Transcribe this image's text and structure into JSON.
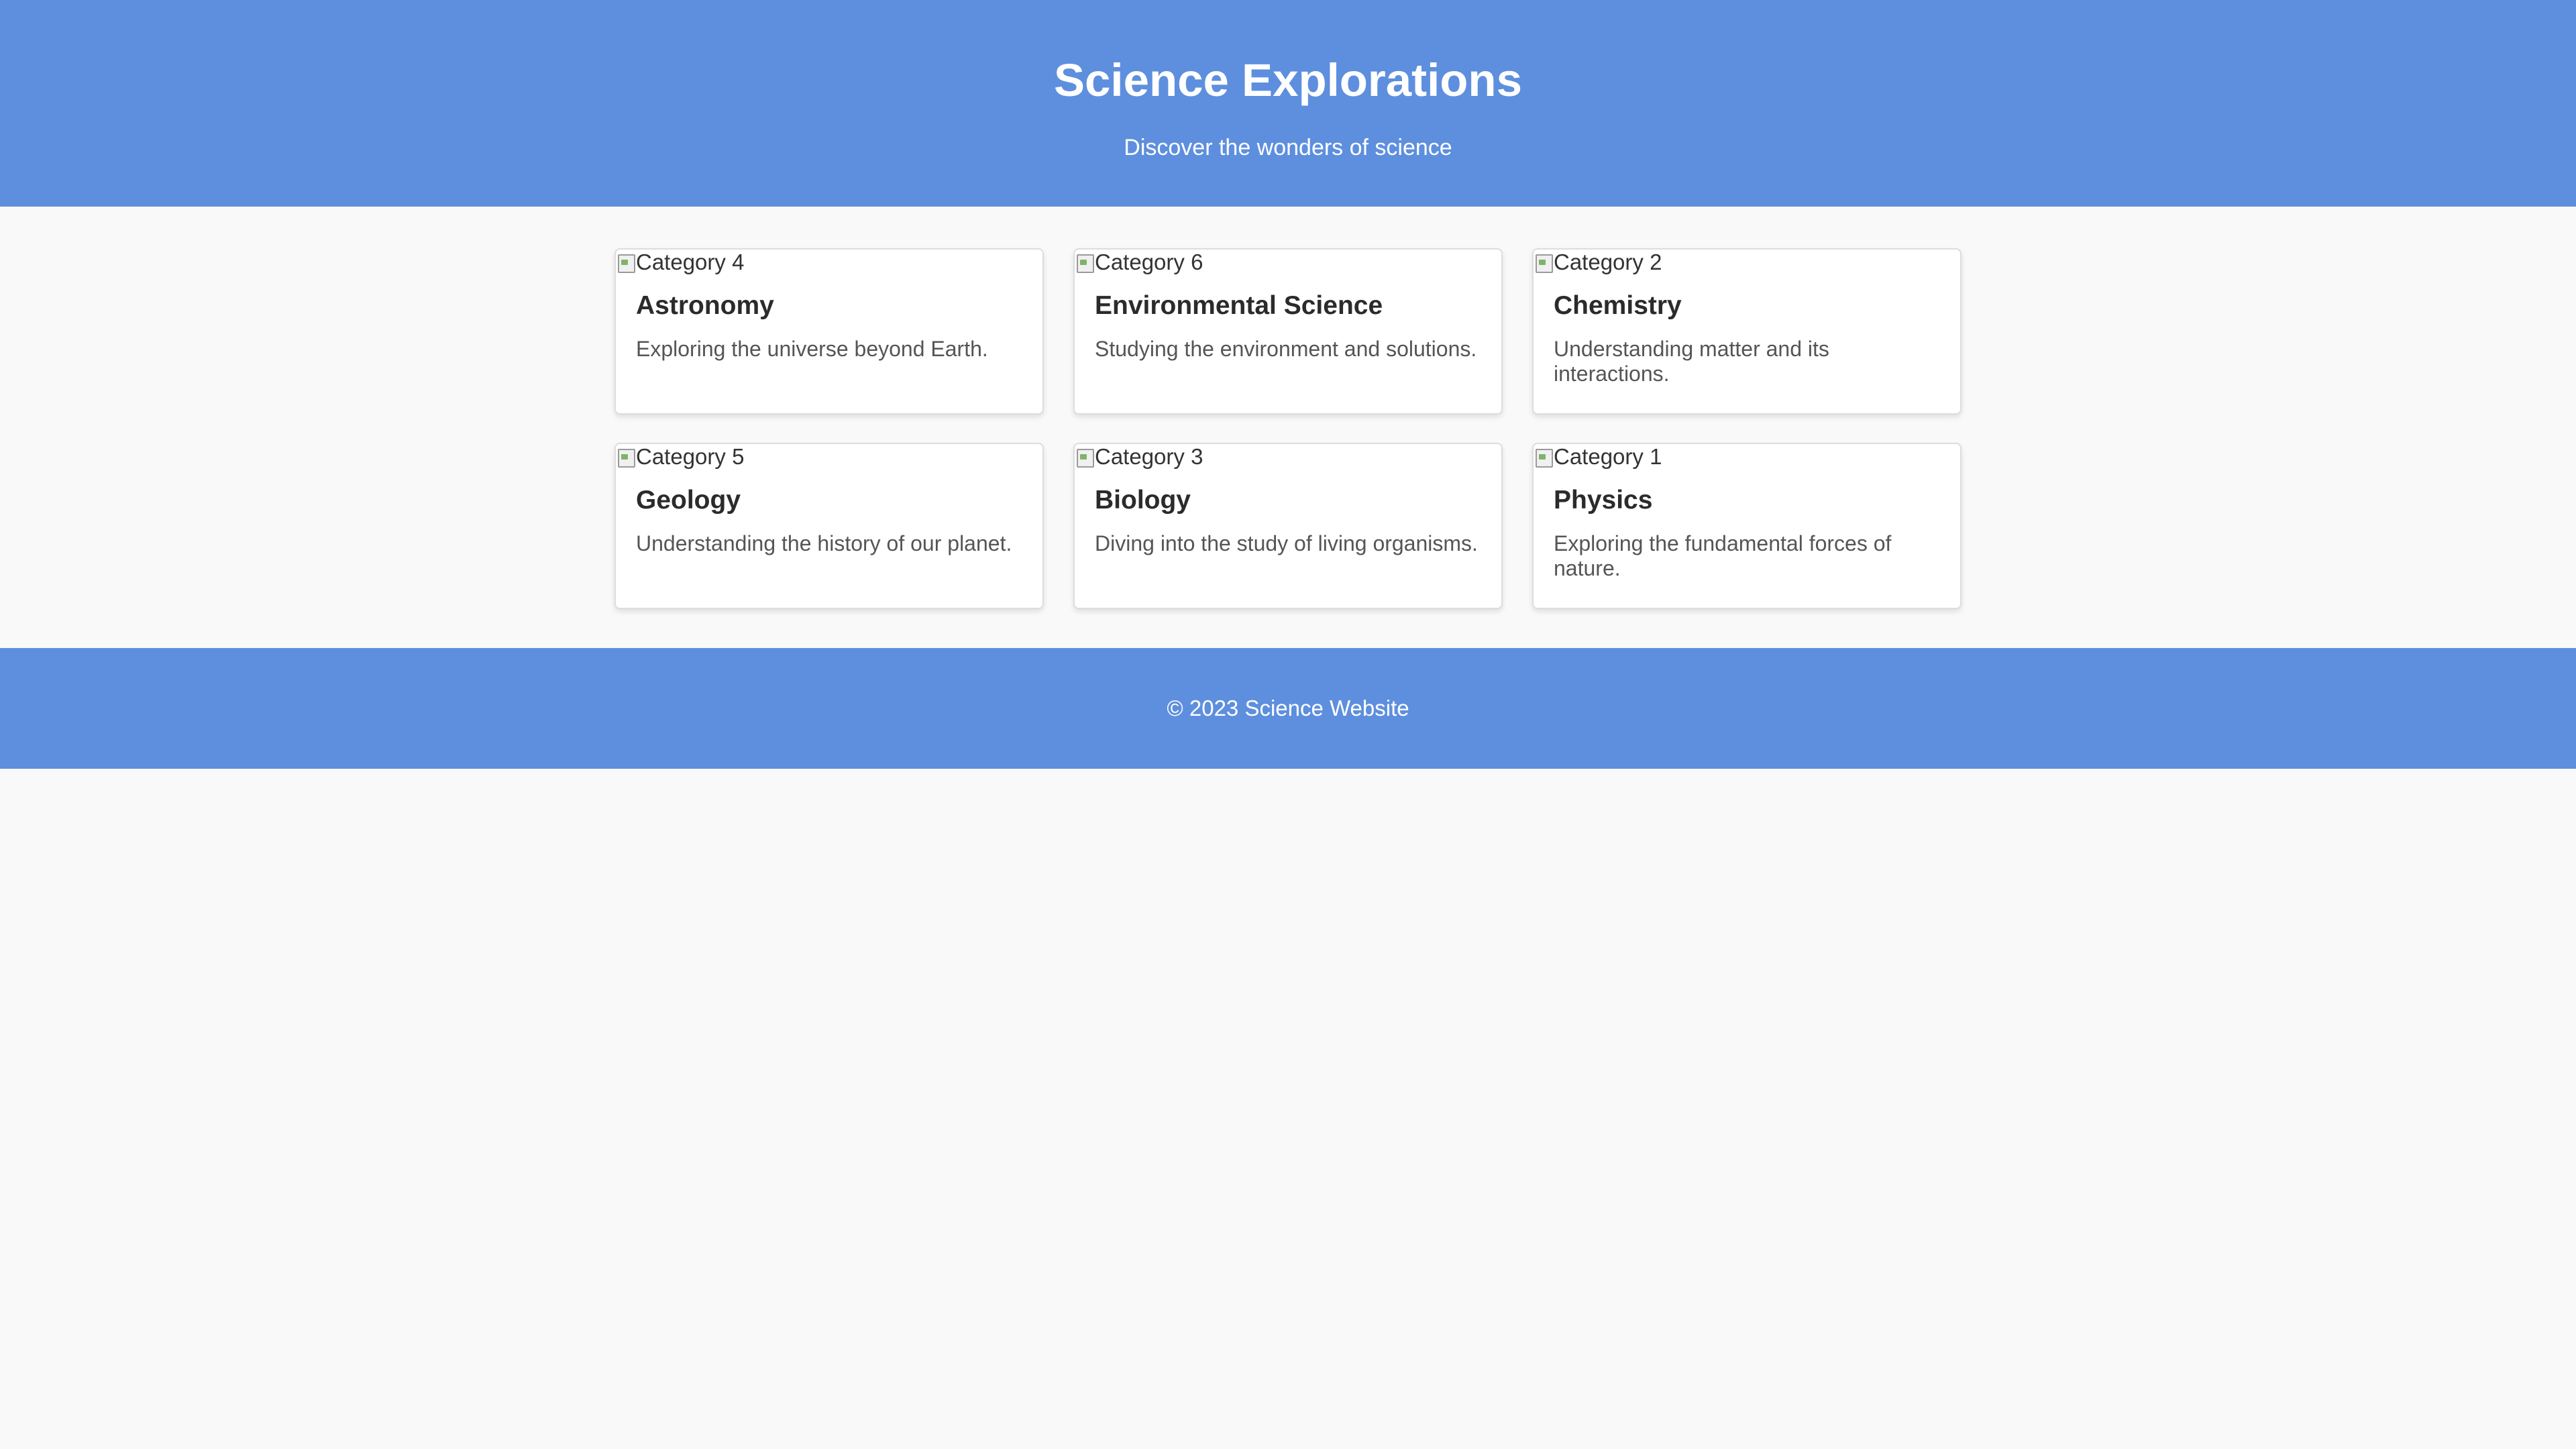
{
  "header": {
    "title": "Science Explorations",
    "subtitle": "Discover the wonders of science"
  },
  "cards": [
    {
      "image_alt": "Category 4",
      "title": "Astronomy",
      "description": "Exploring the universe beyond Earth."
    },
    {
      "image_alt": "Category 6",
      "title": "Environmental Science",
      "description": "Studying the environment and solutions."
    },
    {
      "image_alt": "Category 2",
      "title": "Chemistry",
      "description": "Understanding matter and its interactions."
    },
    {
      "image_alt": "Category 5",
      "title": "Geology",
      "description": "Understanding the history of our planet."
    },
    {
      "image_alt": "Category 3",
      "title": "Biology",
      "description": "Diving into the study of living organisms."
    },
    {
      "image_alt": "Category 1",
      "title": "Physics",
      "description": "Exploring the fundamental forces of nature."
    }
  ],
  "footer": {
    "copyright": "© 2023 Science Website"
  },
  "colors": {
    "header_bg": "#5e8fde",
    "page_bg": "#f9f9f9",
    "card_bg": "#ffffff",
    "title_text": "#2b2b2b",
    "description_text": "#555555"
  },
  "icons": {
    "card_image": "broken-image-icon"
  }
}
